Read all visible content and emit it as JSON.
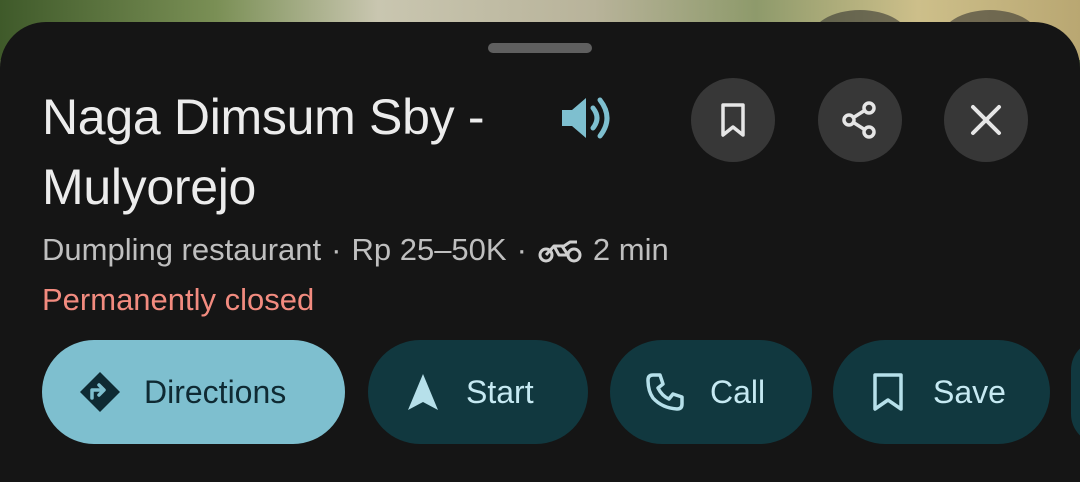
{
  "place": {
    "name": "Naga Dimsum Sby - Mulyorejo",
    "category": "Dumpling restaurant",
    "price": "Rp 25–50K",
    "separator": "·",
    "travel_time": "2 min",
    "status": "Permanently closed"
  },
  "actions": {
    "directions_label": "Directions",
    "start_label": "Start",
    "call_label": "Call",
    "save_label": "Save"
  },
  "icons": {
    "speaker": "volume-up-icon",
    "bookmark": "bookmark-icon",
    "share": "share-icon",
    "close": "close-icon",
    "travel_mode": "motorcycle-icon"
  },
  "colors": {
    "sheet_bg": "#151515",
    "accent": "#7ebfcf",
    "secondary_chip": "#11383f",
    "status_closed": "#f28b7f"
  }
}
